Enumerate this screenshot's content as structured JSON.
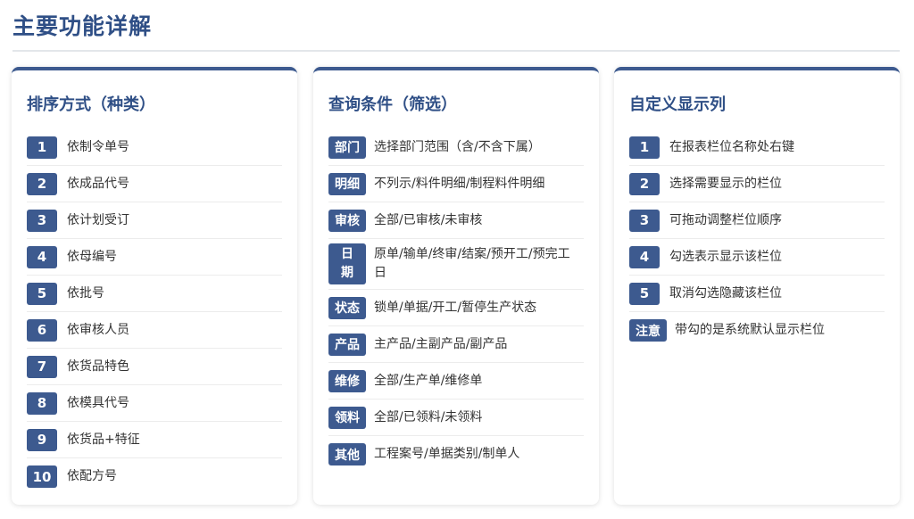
{
  "page": {
    "title": "主要功能详解"
  },
  "colors": {
    "accent": "#3d5a8f",
    "title": "#2f4f86",
    "text": "#333333"
  },
  "cards": [
    {
      "title": "排序方式（种类）",
      "items": [
        {
          "badge": "1",
          "text": "依制令单号"
        },
        {
          "badge": "2",
          "text": "依成品代号"
        },
        {
          "badge": "3",
          "text": "依计划受订"
        },
        {
          "badge": "4",
          "text": "依母编号"
        },
        {
          "badge": "5",
          "text": "依批号"
        },
        {
          "badge": "6",
          "text": "依审核人员"
        },
        {
          "badge": "7",
          "text": "依货品特色"
        },
        {
          "badge": "8",
          "text": "依模具代号"
        },
        {
          "badge": "9",
          "text": "依货品+特征"
        },
        {
          "badge": "10",
          "text": "依配方号"
        }
      ]
    },
    {
      "title": "查询条件（筛选）",
      "items": [
        {
          "badge": "部门",
          "text": "选择部门范围（含/不含下属）"
        },
        {
          "badge": "明细",
          "text": "不列示/料件明细/制程料件明细"
        },
        {
          "badge": "审核",
          "text": "全部/已审核/未审核"
        },
        {
          "badge": [
            "日",
            "期"
          ],
          "text": [
            "原单/输单/终审/结案/预开工/预完工",
            "日"
          ]
        },
        {
          "badge": "状态",
          "text": "锁单/单据/开工/暂停生产状态"
        },
        {
          "badge": "产品",
          "text": "主产品/主副产品/副产品"
        },
        {
          "badge": "维修",
          "text": "全部/生产单/维修单"
        },
        {
          "badge": "领料",
          "text": "全部/已领料/未领料"
        },
        {
          "badge": "其他",
          "text": "工程案号/单据类别/制单人"
        }
      ]
    },
    {
      "title": "自定义显示列",
      "items": [
        {
          "badge": "1",
          "text": "在报表栏位名称处右键"
        },
        {
          "badge": "2",
          "text": "选择需要显示的栏位"
        },
        {
          "badge": "3",
          "text": "可拖动调整栏位顺序"
        },
        {
          "badge": "4",
          "text": "勾选表示显示该栏位"
        },
        {
          "badge": "5",
          "text": "取消勾选隐藏该栏位"
        }
      ],
      "note": {
        "badge": "注意",
        "text": "带勾的是系统默认显示栏位"
      }
    }
  ]
}
